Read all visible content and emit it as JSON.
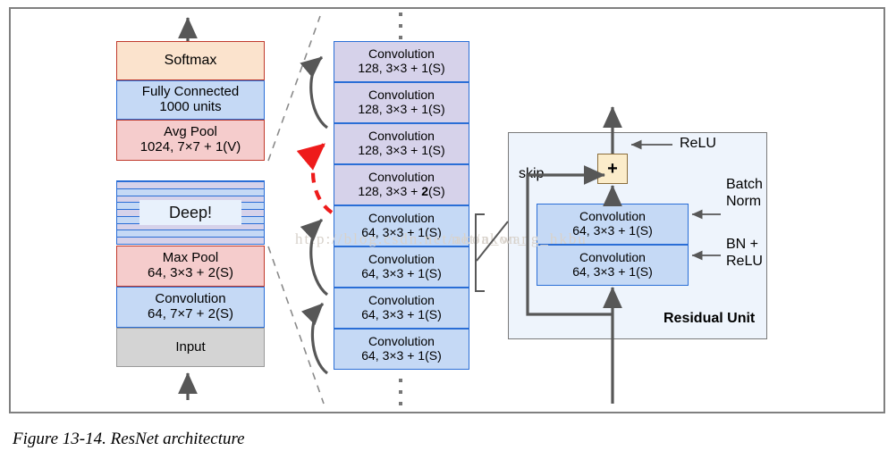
{
  "figure": {
    "caption": "Figure 13-14. ResNet architecture",
    "watermark_left": "http://blog.csdn.net/akon_wang_hkbu",
    "watermark_right": "net/akon_"
  },
  "left_stack": {
    "blocks": [
      {
        "name": "softmax",
        "line1": "Softmax",
        "line2": ""
      },
      {
        "name": "fully-connected",
        "line1": "Fully Connected",
        "line2": "1000 units"
      },
      {
        "name": "avg-pool",
        "line1": "Avg Pool",
        "line2": "1024, 7×7 + 1(V)"
      },
      {
        "name": "deep",
        "line1": "Deep!",
        "line2": ""
      },
      {
        "name": "max-pool",
        "line1": "Max Pool",
        "line2": "64, 3×3 + 2(S)"
      },
      {
        "name": "convolution",
        "line1": "Convolution",
        "line2": "64, 7×7 + 2(S)"
      },
      {
        "name": "input",
        "line1": "Input",
        "line2": ""
      }
    ]
  },
  "middle_stack": {
    "top_dots": "⋮",
    "bottom_dots": "⋮",
    "blocks": [
      {
        "line1": "Convolution",
        "line2_pre": "128, 3×3 + ",
        "stride": "1",
        "stride_bold": false,
        "line2_post": "(S)",
        "group": "128"
      },
      {
        "line1": "Convolution",
        "line2_pre": "128, 3×3 + ",
        "stride": "1",
        "stride_bold": false,
        "line2_post": "(S)",
        "group": "128"
      },
      {
        "line1": "Convolution",
        "line2_pre": "128, 3×3 + ",
        "stride": "1",
        "stride_bold": false,
        "line2_post": "(S)",
        "group": "128"
      },
      {
        "line1": "Convolution",
        "line2_pre": "128, 3×3 + ",
        "stride": "2",
        "stride_bold": true,
        "line2_post": "(S)",
        "group": "128"
      },
      {
        "line1": "Convolution",
        "line2_pre": "64, 3×3 + ",
        "stride": "1",
        "stride_bold": false,
        "line2_post": "(S)",
        "group": "64"
      },
      {
        "line1": "Convolution",
        "line2_pre": "64, 3×3 + ",
        "stride": "1",
        "stride_bold": false,
        "line2_post": "(S)",
        "group": "64"
      },
      {
        "line1": "Convolution",
        "line2_pre": "64, 3×3 + ",
        "stride": "1",
        "stride_bold": false,
        "line2_post": "(S)",
        "group": "64"
      },
      {
        "line1": "Convolution",
        "line2_pre": "64, 3×3 + ",
        "stride": "1",
        "stride_bold": false,
        "line2_post": "(S)",
        "group": "64"
      }
    ]
  },
  "residual_unit": {
    "title": "Residual Unit",
    "plus_symbol": "+",
    "skip_label": "skip",
    "relu_label": "ReLU",
    "batch_norm_label_line1": "Batch",
    "batch_norm_label_line2": "Norm",
    "bn_relu_label_line1": "BN +",
    "bn_relu_label_line2": "ReLU",
    "conv_top": {
      "line1": "Convolution",
      "line2": "64, 3×3 + 1(S)"
    },
    "conv_bottom": {
      "line1": "Convolution",
      "line2": "64, 3×3 + 1(S)"
    }
  },
  "colors": {
    "frame_border": "#808080",
    "peach_fill": "#fbe3cd",
    "red_border": "#c0392b",
    "pink_fill": "#f5cccc",
    "blue_fill": "#c5d9f5",
    "blue_border": "#2a6ed6",
    "lavender_fill": "#d6d2ea",
    "gray_fill": "#d4d4d4",
    "panel_fill": "#eef4fc",
    "plus_fill": "#fbecca",
    "arrow_gray": "#575757",
    "skip_red": "#ee1b1b"
  }
}
